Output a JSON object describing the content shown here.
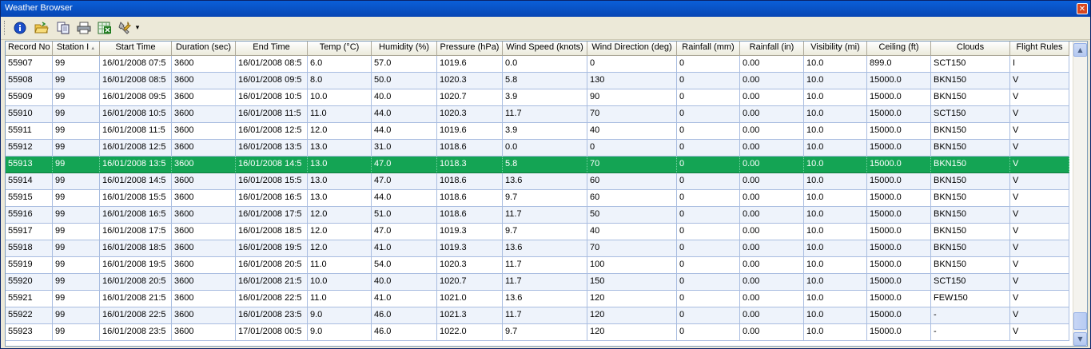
{
  "window": {
    "title": "Weather Browser",
    "close_glyph": "✕"
  },
  "toolbar": {
    "icons": [
      "info-icon",
      "open-folder-icon",
      "copy-icon",
      "print-icon",
      "export-excel-icon",
      "settings-tools-icon"
    ],
    "dropdown_glyph": "▾"
  },
  "table": {
    "columns": [
      "Record No",
      "Station I",
      "Start Time",
      "Duration (sec)",
      "End Time",
      "Temp (°C)",
      "Humidity (%)",
      "Pressure (hPa)",
      "Wind Speed (knots)",
      "Wind Direction (deg)",
      "Rainfall (mm)",
      "Rainfall (in)",
      "Visibility (mi)",
      "Ceiling (ft)",
      "Clouds",
      "Flight Rules"
    ],
    "sort_indicator": "▲",
    "selected_row": 6,
    "rows": [
      [
        "55907",
        "99",
        "16/01/2008 07:5",
        "3600",
        "16/01/2008 08:5",
        "6.0",
        "57.0",
        "1019.6",
        "0.0",
        "0",
        "0",
        "0.00",
        "10.0",
        "899.0",
        "SCT150",
        "I"
      ],
      [
        "55908",
        "99",
        "16/01/2008 08:5",
        "3600",
        "16/01/2008 09:5",
        "8.0",
        "50.0",
        "1020.3",
        "5.8",
        "130",
        "0",
        "0.00",
        "10.0",
        "15000.0",
        "BKN150",
        "V"
      ],
      [
        "55909",
        "99",
        "16/01/2008 09:5",
        "3600",
        "16/01/2008 10:5",
        "10.0",
        "40.0",
        "1020.7",
        "3.9",
        "90",
        "0",
        "0.00",
        "10.0",
        "15000.0",
        "BKN150",
        "V"
      ],
      [
        "55910",
        "99",
        "16/01/2008 10:5",
        "3600",
        "16/01/2008 11:5",
        "11.0",
        "44.0",
        "1020.3",
        "11.7",
        "70",
        "0",
        "0.00",
        "10.0",
        "15000.0",
        "SCT150",
        "V"
      ],
      [
        "55911",
        "99",
        "16/01/2008 11:5",
        "3600",
        "16/01/2008 12:5",
        "12.0",
        "44.0",
        "1019.6",
        "3.9",
        "40",
        "0",
        "0.00",
        "10.0",
        "15000.0",
        "BKN150",
        "V"
      ],
      [
        "55912",
        "99",
        "16/01/2008 12:5",
        "3600",
        "16/01/2008 13:5",
        "13.0",
        "31.0",
        "1018.6",
        "0.0",
        "0",
        "0",
        "0.00",
        "10.0",
        "15000.0",
        "BKN150",
        "V"
      ],
      [
        "55913",
        "99",
        "16/01/2008 13:5",
        "3600",
        "16/01/2008 14:5",
        "13.0",
        "47.0",
        "1018.3",
        "5.8",
        "70",
        "0",
        "0.00",
        "10.0",
        "15000.0",
        "BKN150",
        "V"
      ],
      [
        "55914",
        "99",
        "16/01/2008 14:5",
        "3600",
        "16/01/2008 15:5",
        "13.0",
        "47.0",
        "1018.6",
        "13.6",
        "60",
        "0",
        "0.00",
        "10.0",
        "15000.0",
        "BKN150",
        "V"
      ],
      [
        "55915",
        "99",
        "16/01/2008 15:5",
        "3600",
        "16/01/2008 16:5",
        "13.0",
        "44.0",
        "1018.6",
        "9.7",
        "60",
        "0",
        "0.00",
        "10.0",
        "15000.0",
        "BKN150",
        "V"
      ],
      [
        "55916",
        "99",
        "16/01/2008 16:5",
        "3600",
        "16/01/2008 17:5",
        "12.0",
        "51.0",
        "1018.6",
        "11.7",
        "50",
        "0",
        "0.00",
        "10.0",
        "15000.0",
        "BKN150",
        "V"
      ],
      [
        "55917",
        "99",
        "16/01/2008 17:5",
        "3600",
        "16/01/2008 18:5",
        "12.0",
        "47.0",
        "1019.3",
        "9.7",
        "40",
        "0",
        "0.00",
        "10.0",
        "15000.0",
        "BKN150",
        "V"
      ],
      [
        "55918",
        "99",
        "16/01/2008 18:5",
        "3600",
        "16/01/2008 19:5",
        "12.0",
        "41.0",
        "1019.3",
        "13.6",
        "70",
        "0",
        "0.00",
        "10.0",
        "15000.0",
        "BKN150",
        "V"
      ],
      [
        "55919",
        "99",
        "16/01/2008 19:5",
        "3600",
        "16/01/2008 20:5",
        "11.0",
        "54.0",
        "1020.3",
        "11.7",
        "100",
        "0",
        "0.00",
        "10.0",
        "15000.0",
        "BKN150",
        "V"
      ],
      [
        "55920",
        "99",
        "16/01/2008 20:5",
        "3600",
        "16/01/2008 21:5",
        "10.0",
        "40.0",
        "1020.7",
        "11.7",
        "150",
        "0",
        "0.00",
        "10.0",
        "15000.0",
        "SCT150",
        "V"
      ],
      [
        "55921",
        "99",
        "16/01/2008 21:5",
        "3600",
        "16/01/2008 22:5",
        "11.0",
        "41.0",
        "1021.0",
        "13.6",
        "120",
        "0",
        "0.00",
        "10.0",
        "15000.0",
        "FEW150",
        "V"
      ],
      [
        "55922",
        "99",
        "16/01/2008 22:5",
        "3600",
        "16/01/2008 23:5",
        "9.0",
        "46.0",
        "1021.3",
        "11.7",
        "120",
        "0",
        "0.00",
        "10.0",
        "15000.0",
        "-",
        "V"
      ],
      [
        "55923",
        "99",
        "16/01/2008 23:5",
        "3600",
        "17/01/2008 00:5",
        "9.0",
        "46.0",
        "1022.0",
        "9.7",
        "120",
        "0",
        "0.00",
        "10.0",
        "15000.0",
        "-",
        "V"
      ]
    ]
  },
  "scrollbar": {
    "up_glyph": "▲",
    "down_glyph": "▼"
  },
  "colors": {
    "selection": "#14a454",
    "title_bar": "#0a5fd8",
    "alt_row": "#eef3fb"
  }
}
